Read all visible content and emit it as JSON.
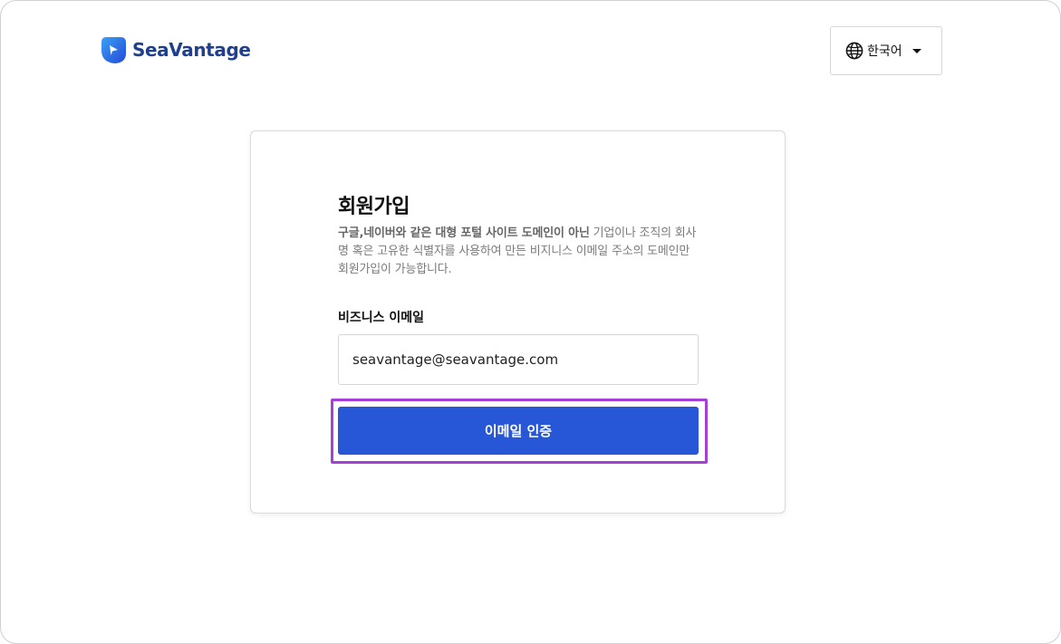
{
  "brand": {
    "name": "SeaVantage",
    "icon": "seavantage-logo-mark",
    "color": "#1f3f8f"
  },
  "language": {
    "icon": "globe-icon",
    "selected": "한국어"
  },
  "signup": {
    "title": "회원가입",
    "description_bold": "구글,네이버와 같은 대형 포털 사이트 도메인이 아닌",
    "description_rest": " 기업이나 조직의 회사명 혹은 고유한 식별자를 사용하여 만든 비지니스 이메일 주소의 도메인만 회원가입이 가능합니다.",
    "email_label": "비즈니스 이메일",
    "email_value": "seavantage@seavantage.com",
    "verify_button": "이메일 인증"
  },
  "colors": {
    "primary": "#2757d7",
    "highlight": "#a53fd6"
  }
}
